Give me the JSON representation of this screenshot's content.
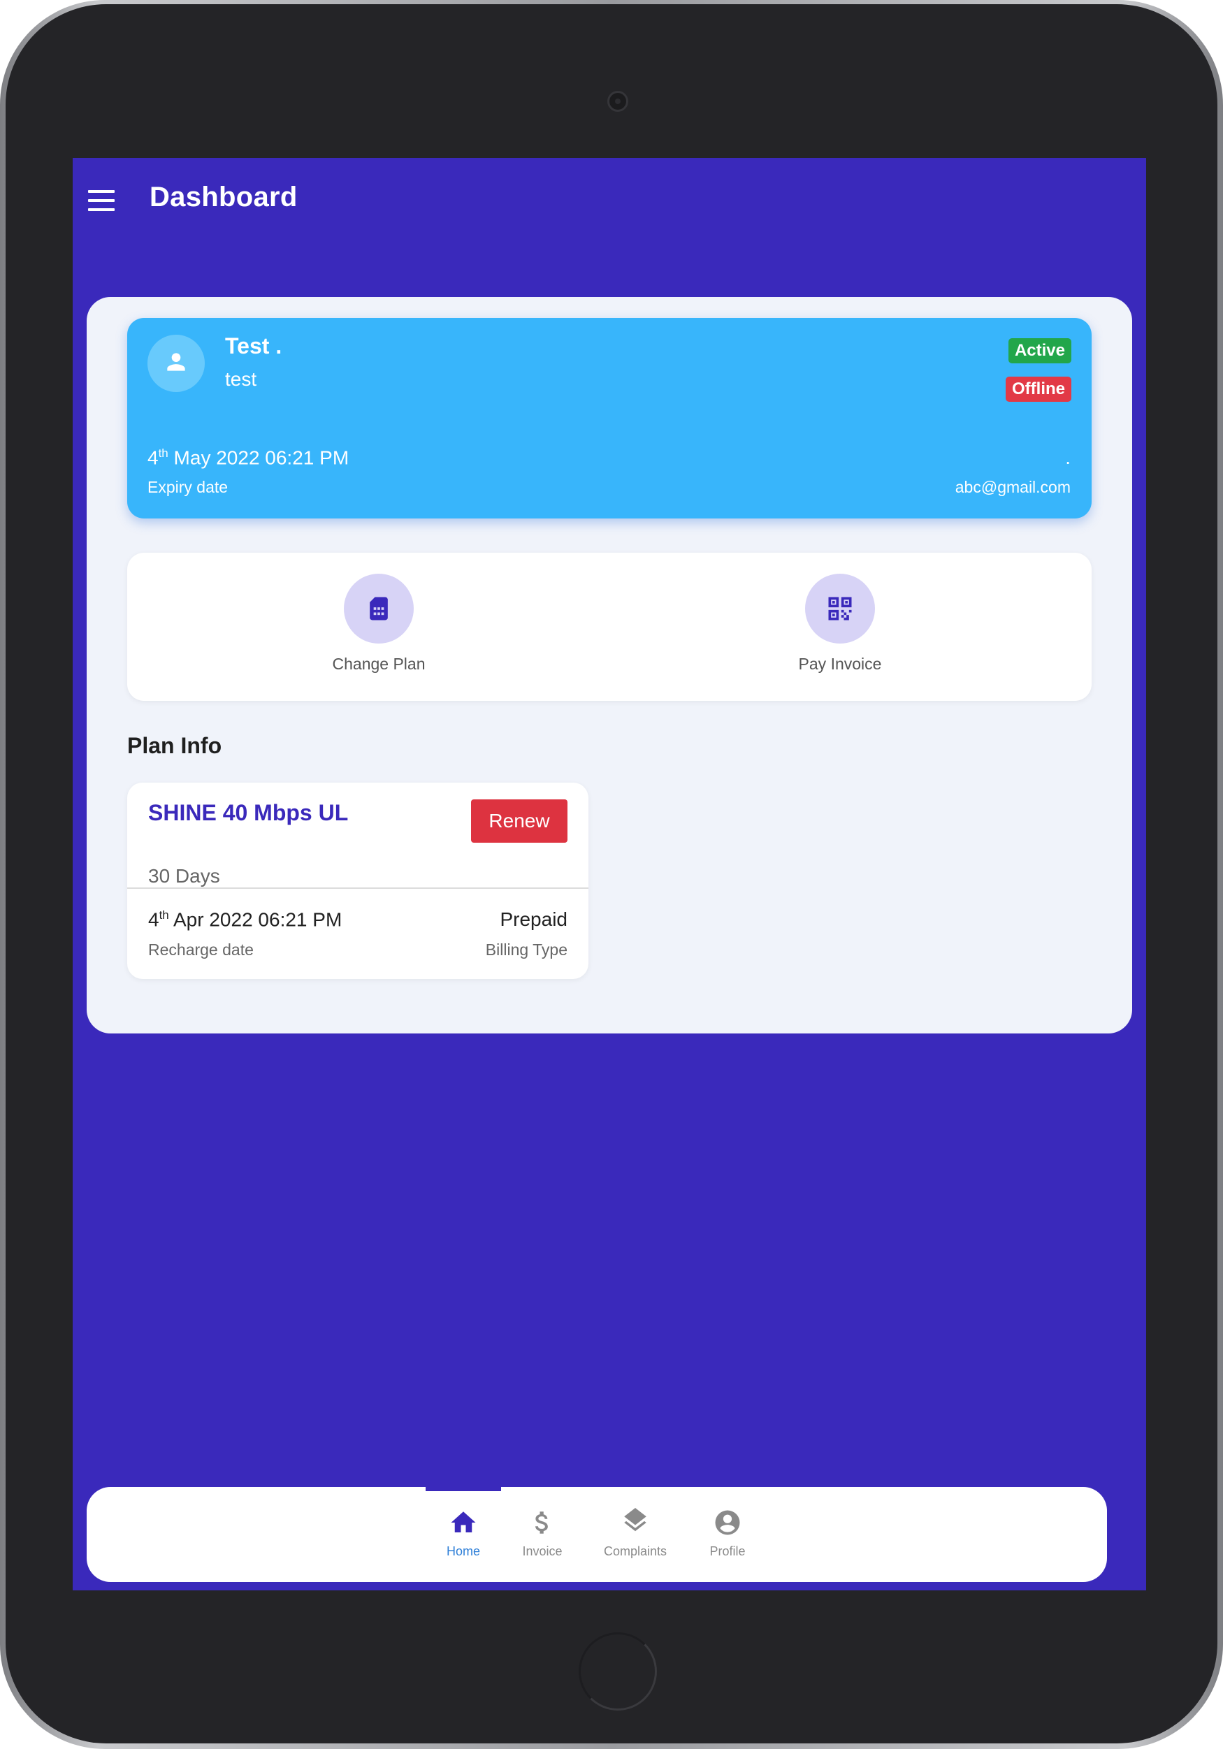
{
  "appbar": {
    "title": "Dashboard"
  },
  "profile": {
    "name": "Test .",
    "username": "test",
    "status_active": "Active",
    "status_connection": "Offline",
    "expiry_day": "4",
    "expiry_suffix": "th",
    "expiry_rest": " May 2022 06:21 PM",
    "expiry_label": "Expiry date",
    "contact_phone": ".",
    "contact_email": "abc@gmail.com"
  },
  "actions": [
    {
      "label": "Change Plan",
      "icon": "sim-card-icon"
    },
    {
      "label": "Pay Invoice",
      "icon": "qr-code-icon"
    }
  ],
  "plan_info": {
    "section_title": "Plan Info",
    "plan_name": "SHINE 40 Mbps UL",
    "duration": "30 Days",
    "renew_label": "Renew",
    "recharge_day": "4",
    "recharge_suffix": "th",
    "recharge_rest": " Apr 2022 06:21 PM",
    "recharge_label": "Recharge date",
    "billing_type": "Prepaid",
    "billing_label": "Billing Type"
  },
  "bottom_nav": {
    "items": [
      {
        "label": "Home",
        "icon": "home-icon",
        "active": true
      },
      {
        "label": "Invoice",
        "icon": "dollar-icon",
        "active": false
      },
      {
        "label": "Complaints",
        "icon": "layers-icon",
        "active": false
      },
      {
        "label": "Profile",
        "icon": "account-circle-icon",
        "active": false
      }
    ]
  },
  "colors": {
    "primary": "#3a29bb",
    "profile_card": "#38b5fb",
    "active_badge": "#22a64a",
    "offline_badge": "#e23946",
    "renew_button": "#dd3340",
    "nav_active": "#2e7fd8"
  }
}
